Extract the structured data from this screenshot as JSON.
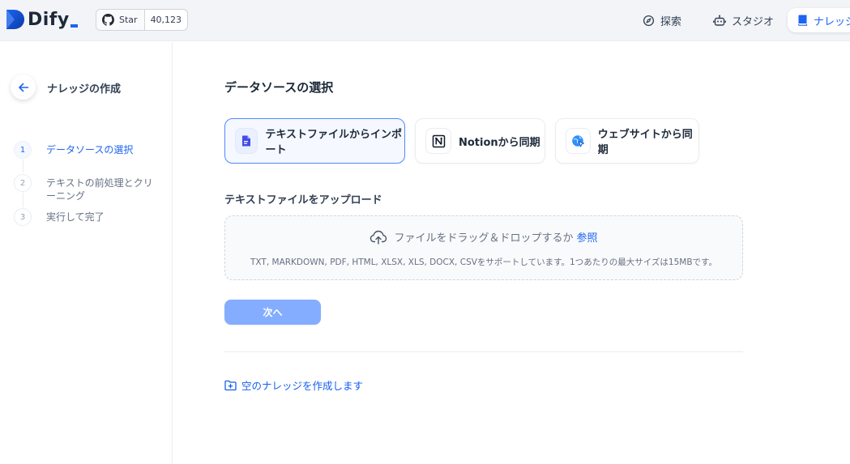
{
  "app": {
    "logo_text": "Dify",
    "github": {
      "label": "Star",
      "count": "40,123"
    }
  },
  "nav": {
    "explore": "探索",
    "studio": "スタジオ",
    "knowledge": "ナレッジ"
  },
  "sidebar": {
    "title": "ナレッジの作成",
    "steps": [
      {
        "num": "1",
        "label": "データソースの選択"
      },
      {
        "num": "2",
        "label": "テキストの前処理とクリーニング"
      },
      {
        "num": "3",
        "label": "実行して完了"
      }
    ]
  },
  "main": {
    "title": "データソースの選択",
    "sources": [
      {
        "label": "テキストファイルからインポート"
      },
      {
        "label": "Notionから同期"
      },
      {
        "label": "ウェブサイトから同期"
      }
    ],
    "upload_title": "テキストファイルをアップロード",
    "dropzone": {
      "prompt": "ファイルをドラッグ＆ドロップするか",
      "browse": "参照",
      "hint": "TXT, MARKDOWN, PDF, HTML, XLSX, XLS, DOCX, CSVをサポートしています。1つあたりの最大サイズは15MBです。"
    },
    "next_button": "次へ",
    "empty_link": "空のナレッジを作成します"
  },
  "colors": {
    "accent": "#1c64f2",
    "selected_border": "#528bff",
    "disabled_button": "#84adff"
  }
}
